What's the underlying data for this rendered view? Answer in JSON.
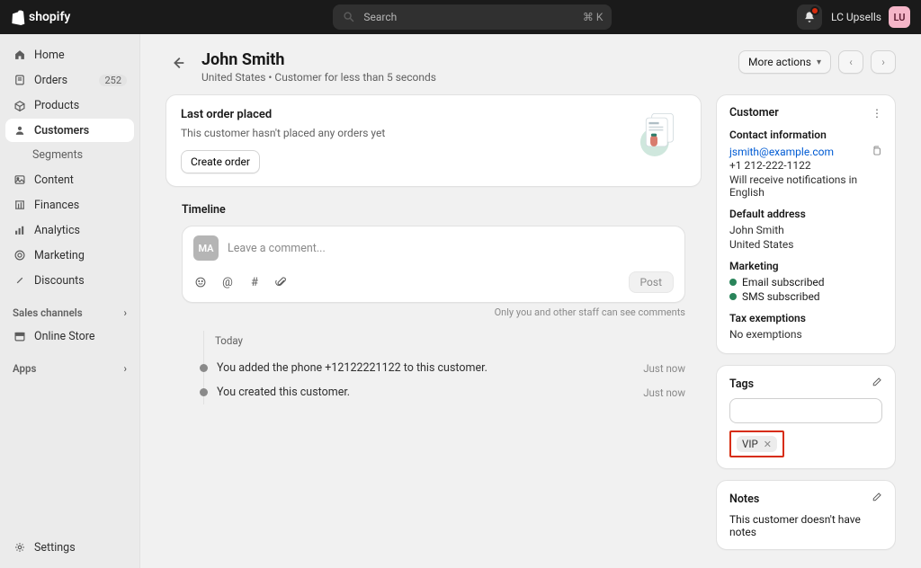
{
  "topbar": {
    "brand": "shopify",
    "search_placeholder": "Search",
    "search_kbd": "⌘ K",
    "account_label": "LC Upsells",
    "account_initials": "LU"
  },
  "sidebar": {
    "home": "Home",
    "orders": "Orders",
    "orders_count": "252",
    "products": "Products",
    "customers": "Customers",
    "segments": "Segments",
    "content": "Content",
    "finances": "Finances",
    "analytics": "Analytics",
    "marketing": "Marketing",
    "discounts": "Discounts",
    "sales_channels": "Sales channels",
    "online_store": "Online Store",
    "apps": "Apps",
    "settings": "Settings"
  },
  "header": {
    "title": "John Smith",
    "subtitle": "United States • Customer for less than 5 seconds",
    "more_actions": "More actions"
  },
  "order_card": {
    "title": "Last order placed",
    "body": "This customer hasn't placed any orders yet",
    "cta": "Create order"
  },
  "timeline": {
    "title": "Timeline",
    "avatar": "MA",
    "placeholder": "Leave a comment...",
    "post": "Post",
    "privacy": "Only you and other staff can see comments",
    "date": "Today",
    "items": [
      {
        "text": "You added the phone +12122221122 to this customer.",
        "when": "Just now"
      },
      {
        "text": "You created this customer.",
        "when": "Just now"
      }
    ]
  },
  "customer": {
    "heading": "Customer",
    "contact_heading": "Contact information",
    "email": "jsmith@example.com",
    "phone": "+1 212-222-1122",
    "lang": "Will receive notifications in English",
    "address_heading": "Default address",
    "address_name": "John Smith",
    "address_country": "United States",
    "marketing_heading": "Marketing",
    "email_status": "Email subscribed",
    "sms_status": "SMS subscribed",
    "tax_heading": "Tax exemptions",
    "tax_body": "No exemptions"
  },
  "tags": {
    "heading": "Tags",
    "chip": "VIP"
  },
  "notes": {
    "heading": "Notes",
    "body": "This customer doesn't have notes"
  }
}
